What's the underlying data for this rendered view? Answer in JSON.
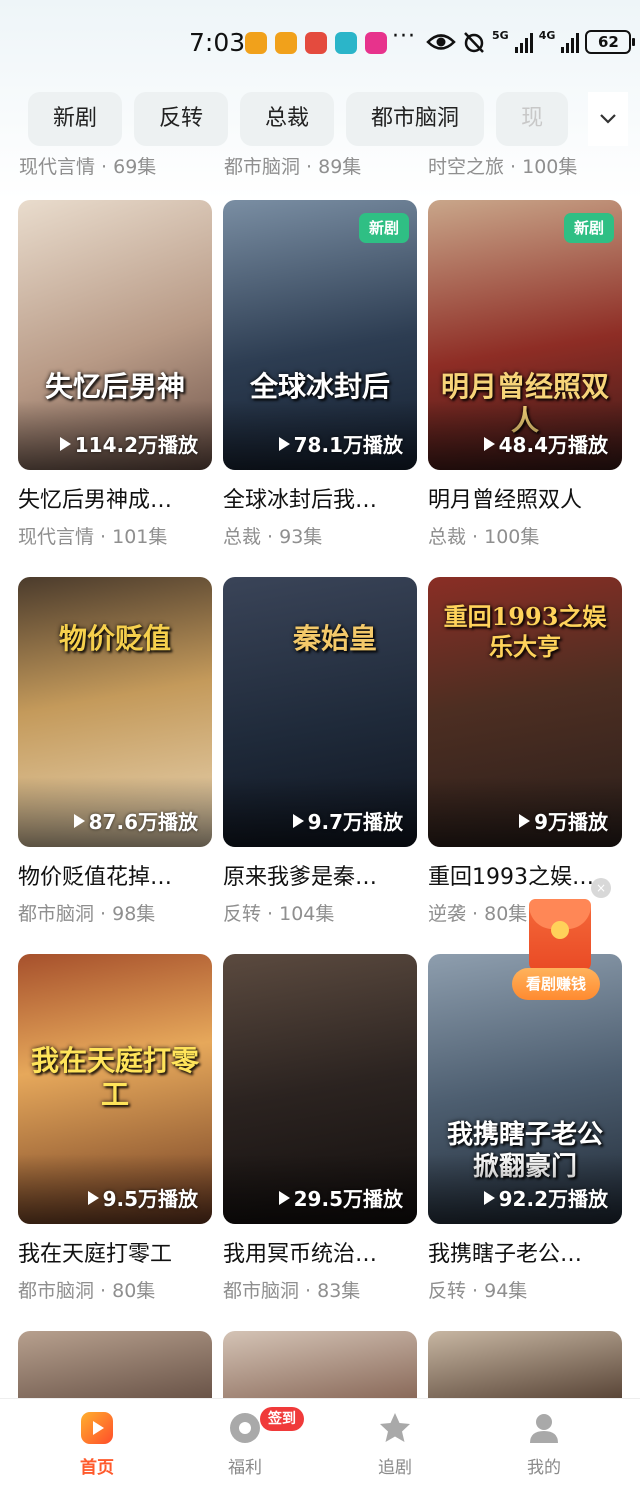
{
  "status_bar": {
    "time": "7:03",
    "dots": "···",
    "signal_5g": "5G",
    "signal_4g": "4G",
    "battery": "62"
  },
  "tabs": [
    "新剧",
    "反转",
    "总裁",
    "都市脑洞",
    "现"
  ],
  "prev_row_meta": [
    "现代言情 · 69集",
    "都市脑洞 · 89集",
    "时空之旅 · 100集"
  ],
  "cards": [
    {
      "title": "失忆后男神成…",
      "meta": "现代言情 · 101集",
      "plays": "114.2万播放",
      "poster_text": "失忆后男神",
      "new": ""
    },
    {
      "title": "全球冰封后我…",
      "meta": "总裁 · 93集",
      "plays": "78.1万播放",
      "poster_text": "全球冰封后",
      "new": "新剧"
    },
    {
      "title": "明月曾经照双人",
      "meta": "总裁 · 100集",
      "plays": "48.4万播放",
      "poster_text": "明月曾经照双人",
      "new": "新剧"
    },
    {
      "title": "物价贬值花掉…",
      "meta": "都市脑洞 · 98集",
      "plays": "87.6万播放",
      "poster_text": "物价贬值",
      "new": ""
    },
    {
      "title": "原来我爹是秦…",
      "meta": "反转 · 104集",
      "plays": "9.7万播放",
      "poster_text": "秦始皇",
      "new": ""
    },
    {
      "title": "重回1993之娱…",
      "meta": "逆袭 · 80集",
      "plays": "9万播放",
      "poster_text": "重回1993之娱乐大亨",
      "new": ""
    },
    {
      "title": "我在天庭打零工",
      "meta": "都市脑洞 · 80集",
      "plays": "9.5万播放",
      "poster_text": "我在天庭打零工",
      "new": ""
    },
    {
      "title": "我用冥币统治…",
      "meta": "都市脑洞 · 83集",
      "plays": "29.5万播放",
      "poster_text": "",
      "new": ""
    },
    {
      "title": "我携瞎子老公…",
      "meta": "反转 · 94集",
      "plays": "92.2万播放",
      "poster_text": "我携瞎子老公掀翻豪门",
      "new": ""
    }
  ],
  "float": {
    "earn_label": "看剧赚钱"
  },
  "nav": {
    "home": "首页",
    "welfare": "福利",
    "signin_badge": "签到",
    "follow": "追剧",
    "mine": "我的"
  },
  "colors": {
    "accent": "#ff5a2c",
    "new_badge": "#2fbf84",
    "tab_bg": "#edf1f2",
    "meta_text": "#8f8f8f"
  }
}
